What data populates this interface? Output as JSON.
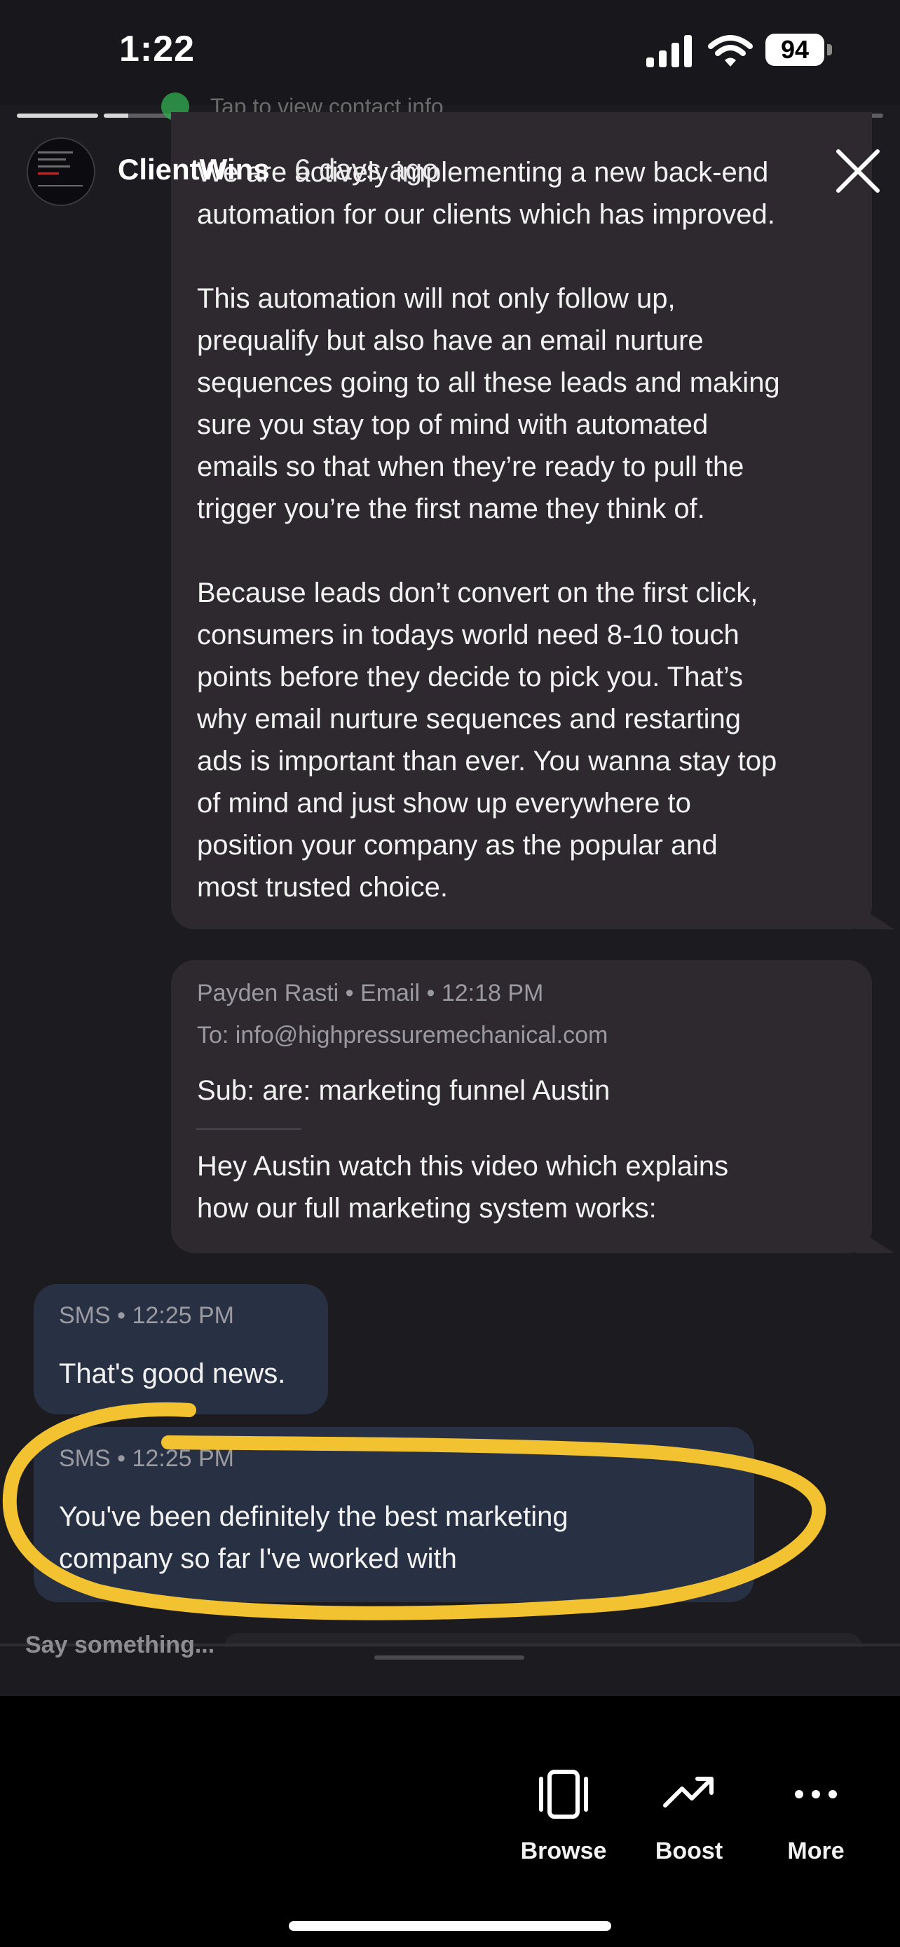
{
  "status_bar": {
    "time": "1:22",
    "battery": "94"
  },
  "story": {
    "progress_segments": 10,
    "current_segment": 2,
    "contact_info_hint": "Tap to view contact info"
  },
  "header": {
    "account_name": "ClientWins",
    "time_ago": "6 days ago"
  },
  "email_1": {
    "paragraphs": [
      [
        "We are actively implementing a new back-end",
        "automation for our clients which has improved."
      ],
      [
        "This automation will not only follow up,",
        "prequalify but also have an email nurture",
        "sequences going to all these leads and making",
        "sure you stay top of mind with automated",
        "emails so that when they’re ready to pull the",
        "trigger you’re the first name they think of."
      ],
      [
        "Because leads don’t convert on the first click,",
        "consumers in todays world need 8-10 touch",
        "points before they decide to pick you. That’s",
        "why email nurture sequences and restarting",
        "ads is important than ever. You wanna stay top",
        "of mind and just show up everywhere to",
        "position your company as the popular and",
        "most trusted choice."
      ]
    ]
  },
  "email_2": {
    "meta": "Payden Rasti • Email • 12:18 PM",
    "to": "To: info@highpressuremechanical.com",
    "subject": "Sub: are: marketing funnel Austin",
    "body": [
      "Hey Austin watch this video which explains",
      "how our full marketing system works:"
    ]
  },
  "sms_1": {
    "meta": "SMS • 12:25 PM",
    "text": "That's good news."
  },
  "sms_2": {
    "meta": "SMS • 12:25 PM",
    "text": [
      "You've been definitely the best marketing",
      "company so far I've worked with"
    ]
  },
  "compose": {
    "placeholder": "Say something..."
  },
  "actions": [
    {
      "label": "Browse",
      "icon": "browse-icon"
    },
    {
      "label": "Boost",
      "icon": "boost-trend-icon"
    },
    {
      "label": "More",
      "icon": "more-dots-icon"
    }
  ],
  "colors": {
    "highlight_ring": "#f2c230",
    "sms_bubble": "#283143",
    "email_bubble": "#2d292f"
  }
}
